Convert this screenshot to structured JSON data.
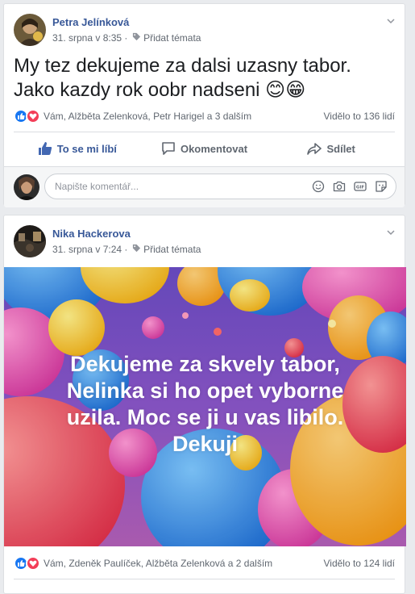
{
  "posts": [
    {
      "author": "Petra Jelínková",
      "date": "31. srpna v 8:35",
      "add_topics": "Přidat témata",
      "text_lines": [
        "My tez dekujeme za dalsi uzasny tabor.",
        "Jako kazdy rok oobr nadseni 😊😁"
      ],
      "reactions_text": "Vám, Alžběta Zelenková, Petr Harigel a 3 dalším",
      "views": "Vidělo to 136 lidí",
      "actions": {
        "like": "To se mi líbí",
        "comment": "Okomentovat",
        "share": "Sdílet"
      },
      "comment_placeholder": "Napište komentář..."
    },
    {
      "author": "Nika Hackerova",
      "date": "31. srpna v 7:24",
      "add_topics": "Přidat témata",
      "banner_lines": [
        "Dekujeme za skvely tabor,",
        "Nelinka si ho opet vyborne",
        "uzila. Moc se ji u vas libilo.",
        "Dekuji"
      ],
      "reactions_text": "Vám, Zdeněk Paulíček, Alžběta Zelenková a 2 dalším",
      "views": "Vidělo to 124 lidí"
    }
  ],
  "icons": {
    "like": "like-icon",
    "love": "heart-icon",
    "tag": "tag-icon",
    "chevron": "chevron-down-icon",
    "comment": "comment-icon",
    "share": "share-icon",
    "emoji": "emoji-icon",
    "camera": "camera-icon",
    "gif": "gif-icon",
    "sticker": "sticker-icon"
  },
  "colors": {
    "link": "#385898",
    "like_blue": "#1877f2",
    "love_red": "#f33e58",
    "page_bg": "#e9ebee"
  }
}
